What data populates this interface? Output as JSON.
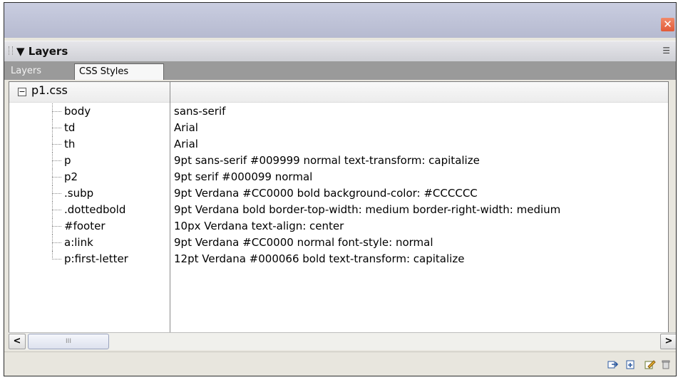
{
  "window": {
    "close_icon": "close-icon",
    "accent": "#e25a38"
  },
  "panel": {
    "title": "▼ Layers",
    "menu_icon": "☰"
  },
  "tabs": [
    {
      "label": "Layers",
      "active": false
    },
    {
      "label": "CSS Styles",
      "active": true
    }
  ],
  "tree": {
    "root": {
      "toggle": "−",
      "label": "p1.css"
    },
    "rules": [
      {
        "selector": "body",
        "properties": "sans-serif"
      },
      {
        "selector": "td",
        "properties": "Arial"
      },
      {
        "selector": "th",
        "properties": "Arial"
      },
      {
        "selector": "p",
        "properties": "9pt sans-serif #009999 normal text-transform: capitalize"
      },
      {
        "selector": "p2",
        "properties": "9pt serif #000099 normal"
      },
      {
        "selector": ".subp",
        "properties": "9pt Verdana #CC0000 bold background-color: #CCCCCC"
      },
      {
        "selector": ".dottedbold",
        "properties": "9pt Verdana bold border-top-width: medium border-right-width: medium"
      },
      {
        "selector": "#footer",
        "properties": "10px Verdana text-align: center"
      },
      {
        "selector": "a:link",
        "properties": "9pt Verdana #CC0000 normal font-style: normal"
      },
      {
        "selector": "p:first-letter",
        "properties": "12pt Verdana #000066 bold text-transform: capitalize"
      }
    ]
  },
  "scrollbar": {
    "left": "<",
    "right": ">",
    "thumb_grip": "III"
  },
  "toolbar": {
    "attach_icon": "attach-stylesheet-icon",
    "new_icon": "new-style-icon",
    "edit_icon": "edit-style-icon",
    "delete_icon": "delete-icon"
  }
}
